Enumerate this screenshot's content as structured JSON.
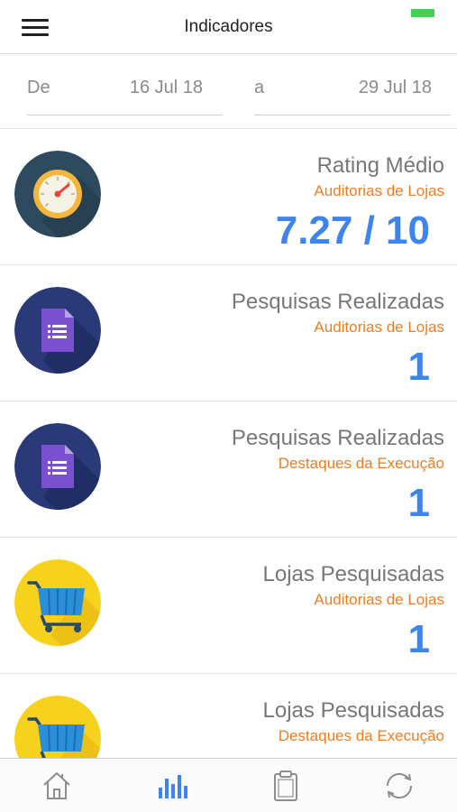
{
  "header": {
    "title": "Indicadores",
    "menu_icon": "hamburger-menu-icon",
    "battery_color": "#3fd353"
  },
  "date_range": {
    "from_label": "De",
    "from_value": "16 Jul 18",
    "to_label": "a",
    "to_value": "29 Jul 18"
  },
  "cards": [
    {
      "icon": "speedometer-icon",
      "title": "Rating Médio",
      "subtitle": "Auditorias de Lojas",
      "value": "7.27 / 10"
    },
    {
      "icon": "form-document-icon",
      "title": "Pesquisas Realizadas",
      "subtitle": "Auditorias de Lojas",
      "value": "1"
    },
    {
      "icon": "form-document-icon",
      "title": "Pesquisas Realizadas",
      "subtitle": "Destaques da Execução",
      "value": "1"
    },
    {
      "icon": "shopping-cart-icon",
      "title": "Lojas Pesquisadas",
      "subtitle": "Auditorias de Lojas",
      "value": "1"
    },
    {
      "icon": "shopping-cart-icon",
      "title": "Lojas Pesquisadas",
      "subtitle": "Destaques da Execução",
      "value": ""
    }
  ],
  "tabbar": {
    "tabs": [
      {
        "icon": "home-icon",
        "active": false
      },
      {
        "icon": "bar-chart-icon",
        "active": true
      },
      {
        "icon": "clipboard-icon",
        "active": false
      },
      {
        "icon": "sync-icon",
        "active": false
      }
    ],
    "active_color": "#3e84ee",
    "inactive_color": "#8e8e8e"
  },
  "colors": {
    "accent_blue": "#3e84ee",
    "subtitle_orange": "#f07c22"
  }
}
